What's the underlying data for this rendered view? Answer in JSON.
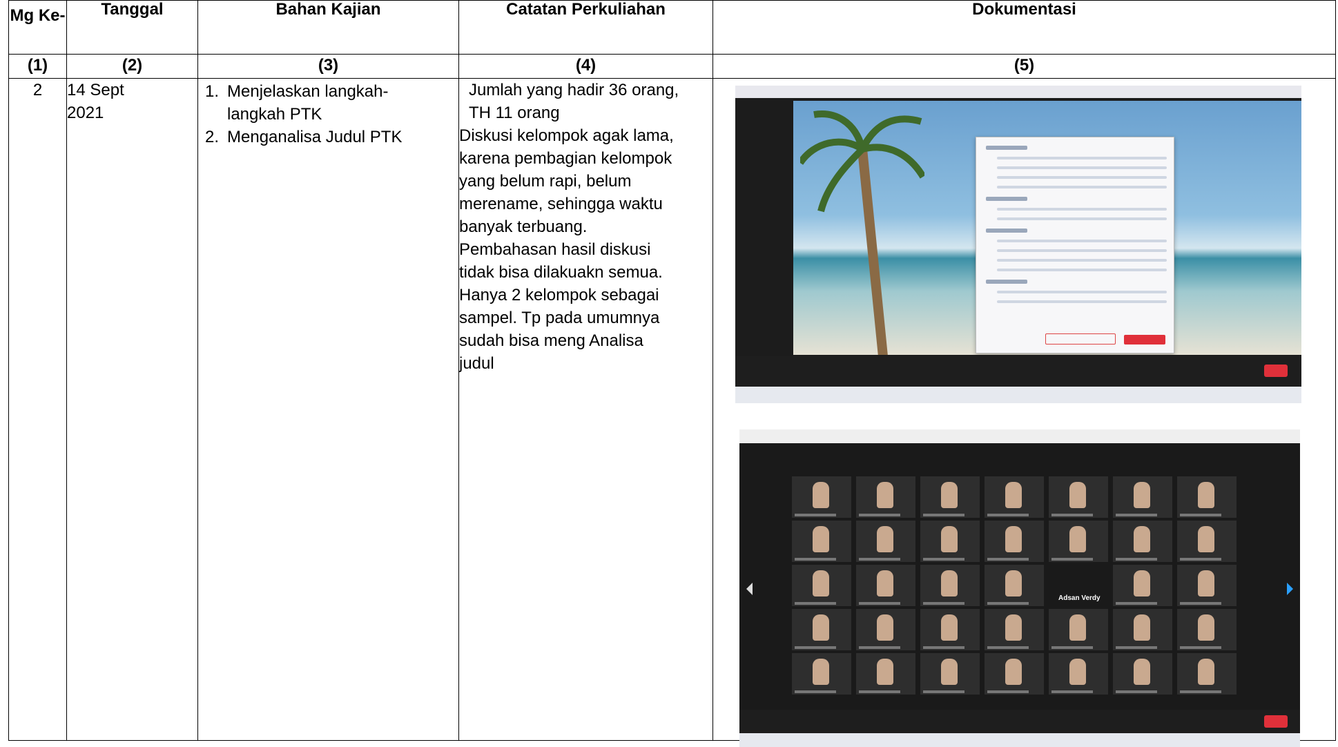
{
  "headers": {
    "col1": "Mg Ke-",
    "col2": "Tanggal",
    "col3": "Bahan Kajian",
    "col4": "Catatan Perkuliahan",
    "col5": "Dokumentasi"
  },
  "numbers": [
    "(1)",
    "(2)",
    "(3)",
    "(4)",
    "(5)"
  ],
  "row": {
    "week": "2",
    "date_line1": "14 Sept",
    "date_line2": "2021",
    "materials": [
      {
        "num": "1.",
        "text_line1": "Menjelaskan langkah-",
        "text_line2": "langkah PTK"
      },
      {
        "num": "2.",
        "text_line1": "Menganalisa Judul PTK",
        "text_line2": ""
      }
    ],
    "notes_indent_line1": "Jumlah yang hadir 36 orang,",
    "notes_indent_line2": "TH 11 orang",
    "notes_lines": [
      "Diskusi kelompok agak lama,",
      "karena pembagian kelompok",
      "yang belum rapi, belum",
      "merename, sehingga waktu",
      "banyak terbuang.",
      "Pembahasan hasil diskusi",
      "tidak bisa dilakuakn semua.",
      "Hanya 2 kelompok sebagai",
      "sampel. Tp pada umumnya",
      "sudah bisa meng Analisa",
      "judul"
    ]
  },
  "documentation": {
    "gallery_label": "Adsan Verdy"
  }
}
